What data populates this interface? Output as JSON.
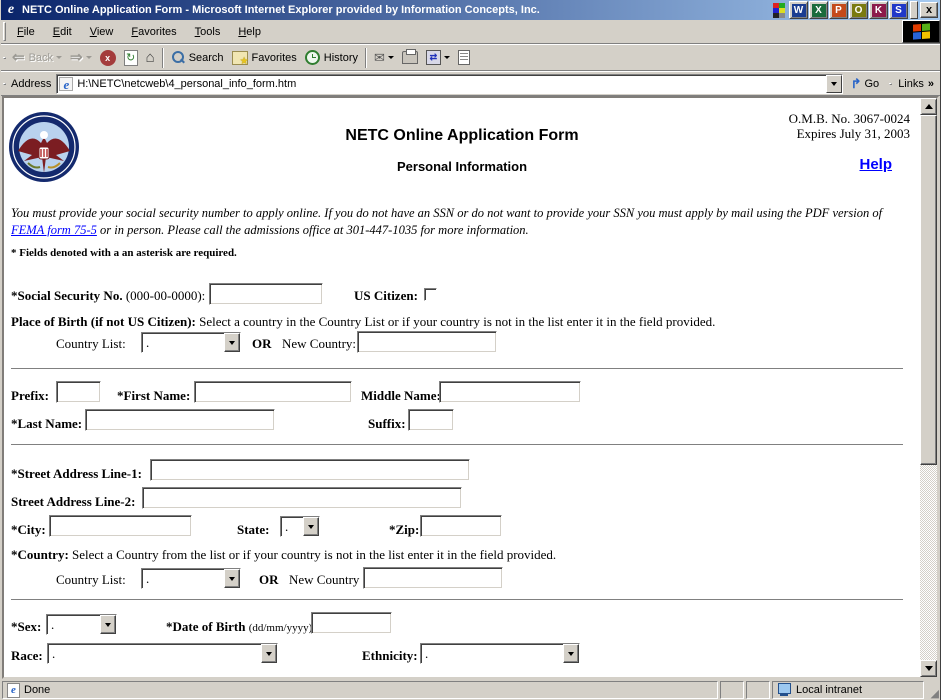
{
  "window": {
    "title": "NETC Online Application Form - Microsoft Internet Explorer provided by Information Concepts, Inc.",
    "close_label": "x",
    "titlebar_buttons": [
      {
        "name": "word",
        "glyph": "W",
        "color": "#1b3d91"
      },
      {
        "name": "excel",
        "glyph": "X",
        "color": "#1a6b3c"
      },
      {
        "name": "publisher",
        "glyph": "P",
        "color": "#c44a1a"
      },
      {
        "name": "clock",
        "glyph": "O",
        "color": "#7a7a10"
      },
      {
        "name": "key",
        "glyph": "K",
        "color": "#8c1a4b"
      },
      {
        "name": "fullscreen",
        "glyph": "S",
        "color": "#2038c8"
      }
    ]
  },
  "menu": {
    "items": [
      "File",
      "Edit",
      "View",
      "Favorites",
      "Tools",
      "Help"
    ]
  },
  "toolbar": {
    "back_label": "Back",
    "stop_glyph": "x",
    "refresh_glyph": "↻",
    "home_glyph": "⌂",
    "search_label": "Search",
    "favorites_label": "Favorites",
    "history_label": "History",
    "mail_glyph": "✉",
    "edit_glyph": "⇄"
  },
  "address_bar": {
    "label": "Address",
    "ie_glyph": "e",
    "url": "H:\\NETC\\netcweb\\4_personal_info_form.htm",
    "go_glyph": "↱",
    "go_label": "Go",
    "links_label": "Links",
    "links_chevron": "»"
  },
  "page": {
    "header": {
      "title": "NETC Online Application Form",
      "omb_no": "O.M.B. No. 3067-0024",
      "expires": "Expires July 31, 2003",
      "subtitle": "Personal Information",
      "help_link": "Help"
    },
    "notice": {
      "part1": "You must provide your social security number to apply online.  If you do not have an SSN or do not want to provide your SSN you must apply by mail using the PDF version of ",
      "link": "FEMA form 75-5",
      "part2": " or in person.  Please call the admissions office at 301-447-1035 for more information."
    },
    "required_note": "* Fields denoted with a an asterisk are required.",
    "ssn": {
      "label_bold": "*Social Security No. ",
      "label_normal": "(000-00-0000):",
      "value": ""
    },
    "us_citizen_label": "US Citizen:",
    "place_of_birth": {
      "label_bold": "Place of Birth (if not US Citizen):",
      "label_normal": " Select a country in the Country List or if your country is not in the list enter it in the field provided."
    },
    "country1": {
      "list_label": "Country List:",
      "selected": ".",
      "or_label": "OR",
      "new_label": "New Country:",
      "new_value": ""
    },
    "names": {
      "prefix_label": "Prefix:",
      "prefix_value": "",
      "first_label": "*First Name:",
      "first_value": "",
      "middle_label": "Middle Name:",
      "middle_value": "",
      "last_label": "*Last Name:",
      "last_value": "",
      "suffix_label": "Suffix:",
      "suffix_value": ""
    },
    "address": {
      "street1_label": "*Street Address Line-1:",
      "street1_value": "",
      "street2_label": "Street Address Line-2:",
      "street2_value": "",
      "city_label": "*City:",
      "city_value": "",
      "state_label": "State:",
      "state_selected": ".",
      "zip_label": "*Zip:",
      "zip_value": "",
      "country_label_bold": "*Country:",
      "country_label_normal": " Select a Country from the list or if your country is not in the list enter it in the field provided.",
      "country2": {
        "list_label": "Country List:",
        "selected": ".",
        "or_label": "OR",
        "new_label": "New Country",
        "new_value": ""
      }
    },
    "demographics": {
      "sex_label": "*Sex:",
      "sex_selected": ".",
      "dob_label_bold": "*Date of Birth ",
      "dob_label_normal": "(dd/mm/yyyy):",
      "dob_value": "",
      "race_label": "Race:",
      "race_selected": ".",
      "ethnicity_label": "Ethnicity:",
      "ethnicity_selected": "."
    }
  },
  "status_bar": {
    "status": "Done",
    "zone": "Local intranet"
  },
  "colors": {
    "titlebar_start": "#0a246a",
    "titlebar_end": "#a6caf0",
    "chrome": "#d4d0c8",
    "link_blue": "#0000ff",
    "seal_navy": "#142a6e",
    "seal_field": "#b9d2ee",
    "seal_eagle": "#7b1d22"
  }
}
